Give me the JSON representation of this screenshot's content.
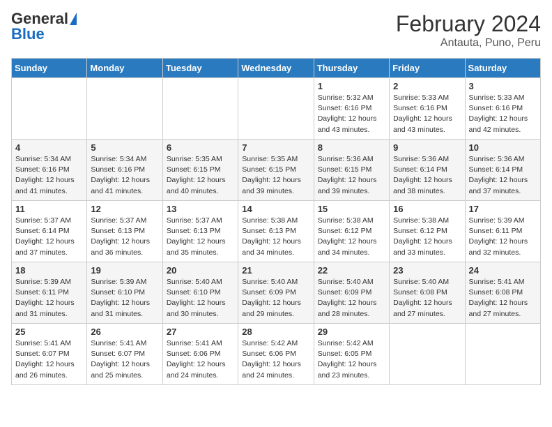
{
  "logo": {
    "general": "General",
    "blue": "Blue"
  },
  "title": "February 2024",
  "subtitle": "Antauta, Puno, Peru",
  "days_of_week": [
    "Sunday",
    "Monday",
    "Tuesday",
    "Wednesday",
    "Thursday",
    "Friday",
    "Saturday"
  ],
  "weeks": [
    {
      "days": [
        {
          "num": "",
          "info": ""
        },
        {
          "num": "",
          "info": ""
        },
        {
          "num": "",
          "info": ""
        },
        {
          "num": "",
          "info": ""
        },
        {
          "num": "1",
          "info": "Sunrise: 5:32 AM\nSunset: 6:16 PM\nDaylight: 12 hours\nand 43 minutes."
        },
        {
          "num": "2",
          "info": "Sunrise: 5:33 AM\nSunset: 6:16 PM\nDaylight: 12 hours\nand 43 minutes."
        },
        {
          "num": "3",
          "info": "Sunrise: 5:33 AM\nSunset: 6:16 PM\nDaylight: 12 hours\nand 42 minutes."
        }
      ]
    },
    {
      "days": [
        {
          "num": "4",
          "info": "Sunrise: 5:34 AM\nSunset: 6:16 PM\nDaylight: 12 hours\nand 41 minutes."
        },
        {
          "num": "5",
          "info": "Sunrise: 5:34 AM\nSunset: 6:16 PM\nDaylight: 12 hours\nand 41 minutes."
        },
        {
          "num": "6",
          "info": "Sunrise: 5:35 AM\nSunset: 6:15 PM\nDaylight: 12 hours\nand 40 minutes."
        },
        {
          "num": "7",
          "info": "Sunrise: 5:35 AM\nSunset: 6:15 PM\nDaylight: 12 hours\nand 39 minutes."
        },
        {
          "num": "8",
          "info": "Sunrise: 5:36 AM\nSunset: 6:15 PM\nDaylight: 12 hours\nand 39 minutes."
        },
        {
          "num": "9",
          "info": "Sunrise: 5:36 AM\nSunset: 6:14 PM\nDaylight: 12 hours\nand 38 minutes."
        },
        {
          "num": "10",
          "info": "Sunrise: 5:36 AM\nSunset: 6:14 PM\nDaylight: 12 hours\nand 37 minutes."
        }
      ]
    },
    {
      "days": [
        {
          "num": "11",
          "info": "Sunrise: 5:37 AM\nSunset: 6:14 PM\nDaylight: 12 hours\nand 37 minutes."
        },
        {
          "num": "12",
          "info": "Sunrise: 5:37 AM\nSunset: 6:13 PM\nDaylight: 12 hours\nand 36 minutes."
        },
        {
          "num": "13",
          "info": "Sunrise: 5:37 AM\nSunset: 6:13 PM\nDaylight: 12 hours\nand 35 minutes."
        },
        {
          "num": "14",
          "info": "Sunrise: 5:38 AM\nSunset: 6:13 PM\nDaylight: 12 hours\nand 34 minutes."
        },
        {
          "num": "15",
          "info": "Sunrise: 5:38 AM\nSunset: 6:12 PM\nDaylight: 12 hours\nand 34 minutes."
        },
        {
          "num": "16",
          "info": "Sunrise: 5:38 AM\nSunset: 6:12 PM\nDaylight: 12 hours\nand 33 minutes."
        },
        {
          "num": "17",
          "info": "Sunrise: 5:39 AM\nSunset: 6:11 PM\nDaylight: 12 hours\nand 32 minutes."
        }
      ]
    },
    {
      "days": [
        {
          "num": "18",
          "info": "Sunrise: 5:39 AM\nSunset: 6:11 PM\nDaylight: 12 hours\nand 31 minutes."
        },
        {
          "num": "19",
          "info": "Sunrise: 5:39 AM\nSunset: 6:10 PM\nDaylight: 12 hours\nand 31 minutes."
        },
        {
          "num": "20",
          "info": "Sunrise: 5:40 AM\nSunset: 6:10 PM\nDaylight: 12 hours\nand 30 minutes."
        },
        {
          "num": "21",
          "info": "Sunrise: 5:40 AM\nSunset: 6:09 PM\nDaylight: 12 hours\nand 29 minutes."
        },
        {
          "num": "22",
          "info": "Sunrise: 5:40 AM\nSunset: 6:09 PM\nDaylight: 12 hours\nand 28 minutes."
        },
        {
          "num": "23",
          "info": "Sunrise: 5:40 AM\nSunset: 6:08 PM\nDaylight: 12 hours\nand 27 minutes."
        },
        {
          "num": "24",
          "info": "Sunrise: 5:41 AM\nSunset: 6:08 PM\nDaylight: 12 hours\nand 27 minutes."
        }
      ]
    },
    {
      "days": [
        {
          "num": "25",
          "info": "Sunrise: 5:41 AM\nSunset: 6:07 PM\nDaylight: 12 hours\nand 26 minutes."
        },
        {
          "num": "26",
          "info": "Sunrise: 5:41 AM\nSunset: 6:07 PM\nDaylight: 12 hours\nand 25 minutes."
        },
        {
          "num": "27",
          "info": "Sunrise: 5:41 AM\nSunset: 6:06 PM\nDaylight: 12 hours\nand 24 minutes."
        },
        {
          "num": "28",
          "info": "Sunrise: 5:42 AM\nSunset: 6:06 PM\nDaylight: 12 hours\nand 24 minutes."
        },
        {
          "num": "29",
          "info": "Sunrise: 5:42 AM\nSunset: 6:05 PM\nDaylight: 12 hours\nand 23 minutes."
        },
        {
          "num": "",
          "info": ""
        },
        {
          "num": "",
          "info": ""
        }
      ]
    }
  ]
}
